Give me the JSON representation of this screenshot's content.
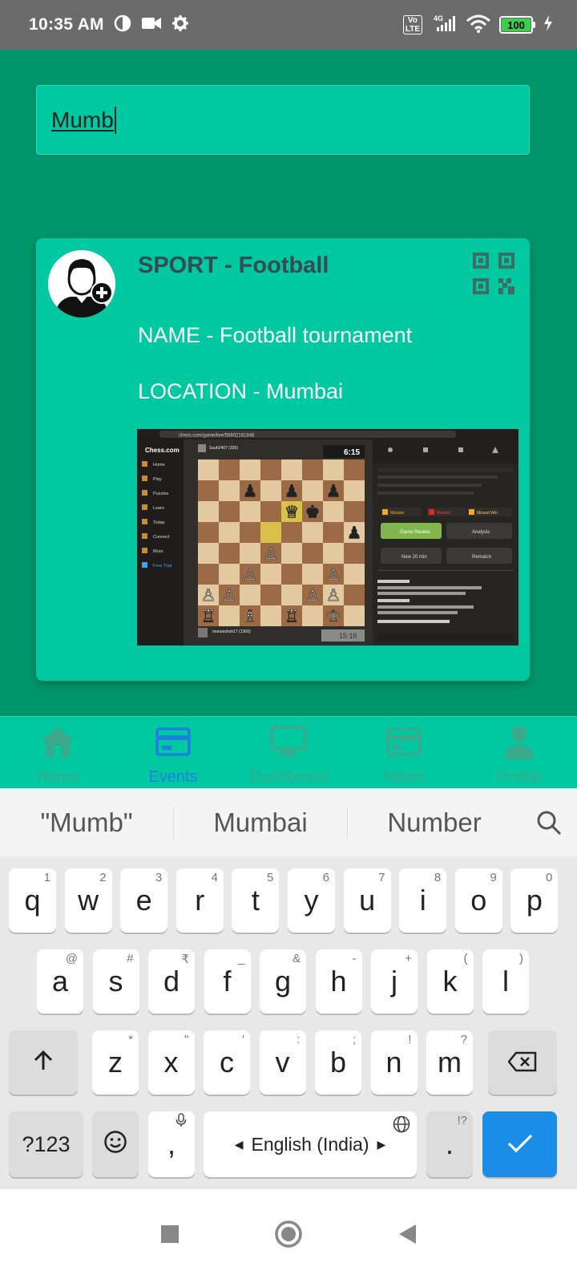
{
  "status_bar": {
    "time": "10:35 AM",
    "volte": "Vo\nLTE",
    "network": "4G",
    "battery": "100"
  },
  "search": {
    "value": "Mumb"
  },
  "event_card": {
    "sport": "SPORT - Football",
    "name": "NAME - Football tournament",
    "location": "LOCATION - Mumbai",
    "image": {
      "site": "Chess.com",
      "url": "chess.com/game/live/58602161848",
      "menu": [
        "Home",
        "Play",
        "Puzzles",
        "Learn",
        "Today",
        "Connect",
        "More",
        "Free Trial"
      ],
      "clock_top": "6:15",
      "clock_bottom": "15:16",
      "opponent": "Suuh2407 (339)",
      "player": "manueshuh17 (1360)",
      "buttons": [
        "Game Review",
        "Analysis",
        "New 20 min",
        "Rematch"
      ],
      "tags": [
        "Mistake",
        "Blunder",
        "Missed Win"
      ]
    }
  },
  "bottom_nav": {
    "items": [
      {
        "label": "Home",
        "icon": "home-icon"
      },
      {
        "label": "Events",
        "icon": "events-icon"
      },
      {
        "label": "Dashboard",
        "icon": "dashboard-icon"
      },
      {
        "label": "News",
        "icon": "news-icon"
      },
      {
        "label": "Profile",
        "icon": "profile-icon"
      }
    ],
    "active": "Events",
    "colors": {
      "active": "#1e7fe0",
      "inactive": "#3ba98a"
    }
  },
  "suggestions": [
    "\"Mumb\"",
    "Mumbai",
    "Number"
  ],
  "keyboard": {
    "row1": [
      [
        "q",
        "1"
      ],
      [
        "w",
        "2"
      ],
      [
        "e",
        "3"
      ],
      [
        "r",
        "4"
      ],
      [
        "t",
        "5"
      ],
      [
        "y",
        "6"
      ],
      [
        "u",
        "7"
      ],
      [
        "i",
        "8"
      ],
      [
        "o",
        "9"
      ],
      [
        "p",
        "0"
      ]
    ],
    "row2": [
      [
        "a",
        "@"
      ],
      [
        "s",
        "#"
      ],
      [
        "d",
        "₹"
      ],
      [
        "f",
        "_"
      ],
      [
        "g",
        "&"
      ],
      [
        "h",
        "-"
      ],
      [
        "j",
        "+"
      ],
      [
        "k",
        "("
      ],
      [
        "l",
        ")"
      ]
    ],
    "row3": [
      [
        "z",
        "*"
      ],
      [
        "x",
        "\""
      ],
      [
        "c",
        "'"
      ],
      [
        "v",
        ":"
      ],
      [
        "b",
        ";"
      ],
      [
        "n",
        "!"
      ],
      [
        "m",
        "?"
      ]
    ],
    "symbols_key": "?123",
    "comma": ",",
    "space_label": "English (India)",
    "period": ".",
    "period_hint": "!?"
  }
}
